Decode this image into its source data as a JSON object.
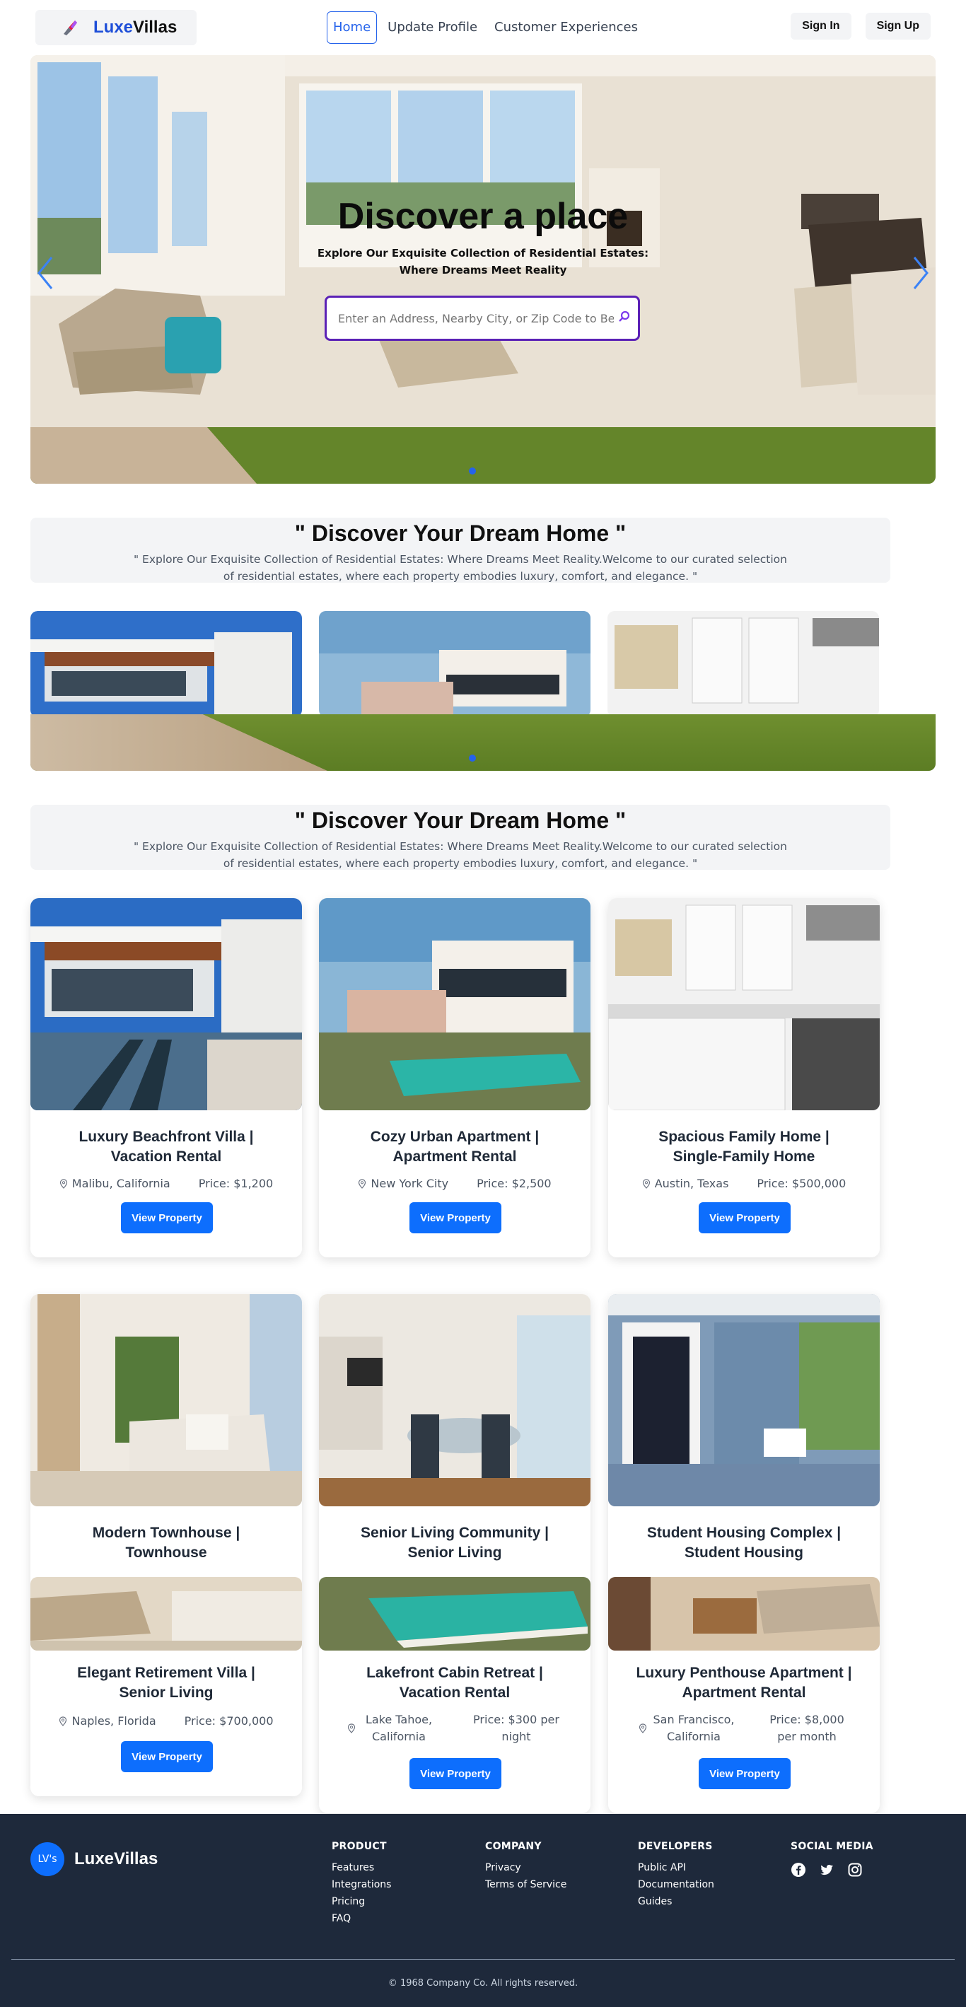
{
  "nav": {
    "brand_prefix": "Luxe",
    "brand_suffix": "Villas",
    "links": [
      "Home",
      "Update Profile",
      "Customer Experiences"
    ],
    "sign_in": "Sign In",
    "sign_up": "Sign Up"
  },
  "hero": {
    "title": "Discover a place",
    "subtitle_1": "Explore Our Exquisite Collection of Residential Estates:",
    "subtitle_2": "Where Dreams Meet Reality",
    "search_placeholder": "Enter an Address, Nearby City, or Zip Code to Begin"
  },
  "section": {
    "title": "\" Discover Your Dream Home \"",
    "text": "\" Explore Our Exquisite Collection of Residential Estates: Where Dreams Meet Reality.Welcome to our curated selection of residential estates, where each property embodies luxury, comfort, and elegance. \""
  },
  "cards": [
    {
      "title": "Luxury Beachfront Villa | Vacation Rental",
      "location": "Malibu, California",
      "price": "Price: $1,200",
      "button": "View Property"
    },
    {
      "title": "Cozy Urban Apartment | Apartment Rental",
      "location": "New York City",
      "price": "Price: $2,500",
      "button": "View Property"
    },
    {
      "title": "Spacious Family Home | Single-Family Home",
      "location": "Austin, Texas",
      "price": "Price: $500,000",
      "button": "View Property"
    },
    {
      "title": "Modern Townhouse | Townhouse"
    },
    {
      "title": "Senior Living Community | Senior Living"
    },
    {
      "title": "Student Housing Complex | Student Housing"
    },
    {
      "title": "Elegant Retirement Villa | Senior Living",
      "location": "Naples, Florida",
      "price": "Price: $700,000",
      "button": "View Property"
    },
    {
      "title": "Lakefront Cabin Retreat | Vacation Rental",
      "location": "Lake Tahoe, California",
      "price": "Price: $300 per night",
      "button": "View Property"
    },
    {
      "title": "Luxury Penthouse Apartment | Apartment Rental",
      "location": "San Francisco, California",
      "price": "Price: $8,000 per month",
      "button": "View Property"
    }
  ],
  "footer": {
    "badge": "LV's",
    "brand": "LuxeVillas",
    "product": {
      "heading": "PRODUCT",
      "links": [
        "Features",
        "Integrations",
        "Pricing",
        "FAQ"
      ]
    },
    "company": {
      "heading": "COMPANY",
      "links": [
        "Privacy",
        "Terms of Service"
      ]
    },
    "developers": {
      "heading": "DEVELOPERS",
      "links": [
        "Public API",
        "Documentation",
        "Guides"
      ]
    },
    "social": {
      "heading": "SOCIAL MEDIA",
      "icons": [
        "facebook-icon",
        "twitter-icon",
        "instagram-icon"
      ]
    },
    "copyright": "© 1968 Company Co. All rights reserved."
  },
  "colors": {
    "accent": "#0d6efd",
    "footer_bg": "#1e293b",
    "search_border": "#5b21b6"
  }
}
